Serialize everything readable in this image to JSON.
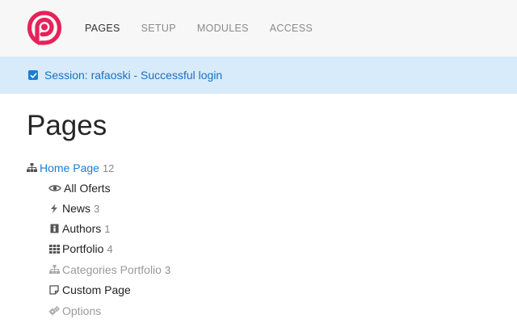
{
  "nav": {
    "items": [
      {
        "label": "PAGES"
      },
      {
        "label": "SETUP"
      },
      {
        "label": "MODULES"
      },
      {
        "label": "ACCESS"
      }
    ]
  },
  "alert": {
    "message": "Session: rafaoski - Successful login"
  },
  "page": {
    "title": "Pages"
  },
  "tree": {
    "root": {
      "label": "Home Page",
      "count": "12",
      "icon": "sitemap-icon"
    },
    "children": [
      {
        "label": "All Oferts",
        "count": "",
        "icon": "eye-icon"
      },
      {
        "label": "News",
        "count": "3",
        "icon": "bolt-icon"
      },
      {
        "label": "Authors",
        "count": "1",
        "icon": "id-card-icon"
      },
      {
        "label": "Portfolio",
        "count": "4",
        "icon": "grid-icon"
      },
      {
        "label": "Categories Portfolio",
        "count": "3",
        "icon": "sitemap-icon"
      },
      {
        "label": "Custom Page",
        "count": "",
        "icon": "sticky-note-icon"
      },
      {
        "label": "Options",
        "count": "",
        "icon": "cogs-icon"
      }
    ]
  },
  "colors": {
    "brand": "#e8215a",
    "link": "#1a7ed6",
    "alert_bg": "#d8ebfb",
    "muted": "#9a9a9a"
  }
}
